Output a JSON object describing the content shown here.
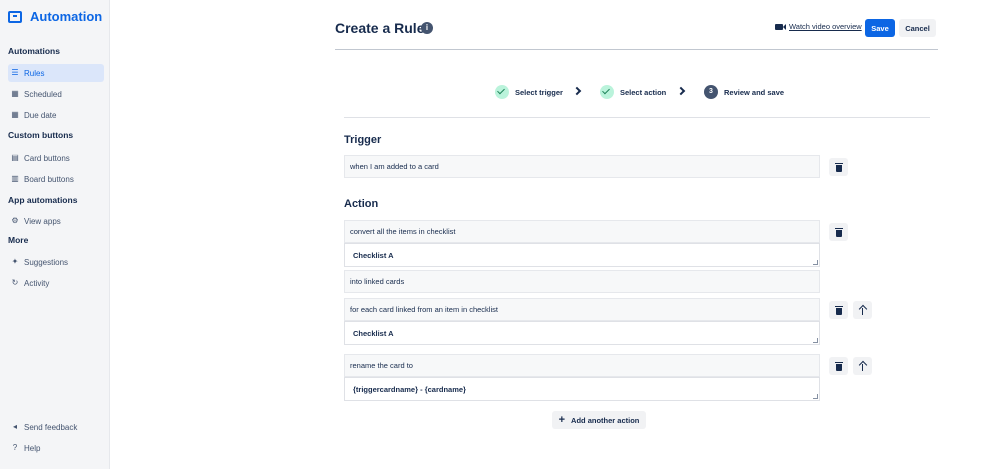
{
  "sidebar": {
    "brand": "Automation",
    "sections": {
      "automations": "Automations",
      "custom_buttons": "Custom buttons",
      "app_automations": "App automations",
      "more": "More"
    },
    "items": {
      "rules": "Rules",
      "scheduled": "Scheduled",
      "due_date": "Due date",
      "card_buttons": "Card buttons",
      "board_buttons": "Board buttons",
      "view_apps": "View apps",
      "suggestions": "Suggestions",
      "activity": "Activity",
      "send_feedback": "Send feedback",
      "help": "Help"
    },
    "active_item": "Rules"
  },
  "header": {
    "title": "Create a Rule",
    "video_link": "Watch video overview",
    "save": "Save",
    "cancel": "Cancel"
  },
  "steps": [
    {
      "label": "Select trigger",
      "state": "done"
    },
    {
      "label": "Select action",
      "state": "done"
    },
    {
      "label": "Review and save",
      "state": "current",
      "number": "3"
    }
  ],
  "trigger": {
    "heading": "Trigger",
    "text": "when I am added to a card"
  },
  "action": {
    "heading": "Action",
    "block1": {
      "text": "convert all the items in checklist",
      "input": "Checklist A",
      "suffix": "into linked cards"
    },
    "block2": {
      "text": "for each card linked from an item in checklist",
      "input": "Checklist A"
    },
    "block3": {
      "text": "rename the card to",
      "input": "{triggercardname} - {cardname}"
    },
    "add_button": "Add another action"
  },
  "colors": {
    "accent": "#0c66e4",
    "step_done_bg": "#baf3db",
    "step_done_check": "#1f845a",
    "sidebar_bg": "#f4f5f7"
  }
}
